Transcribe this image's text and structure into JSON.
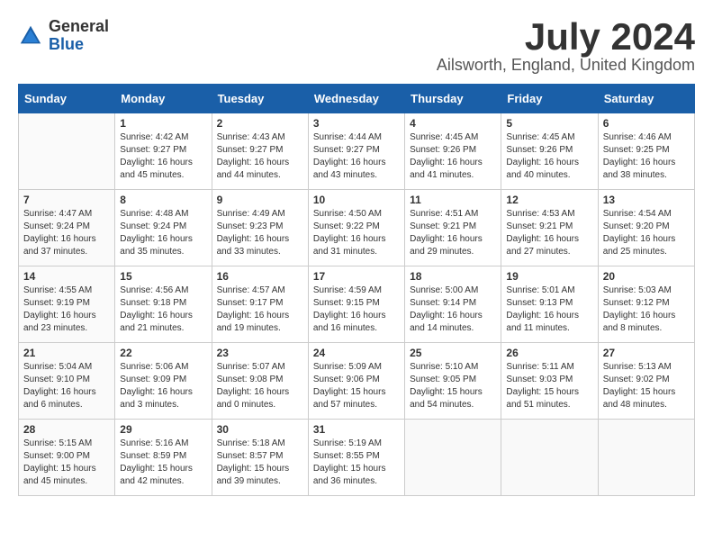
{
  "logo": {
    "general": "General",
    "blue": "Blue"
  },
  "title": {
    "month_year": "July 2024",
    "location": "Ailsworth, England, United Kingdom"
  },
  "days_of_week": [
    "Sunday",
    "Monday",
    "Tuesday",
    "Wednesday",
    "Thursday",
    "Friday",
    "Saturday"
  ],
  "weeks": [
    [
      {
        "day": "",
        "info": ""
      },
      {
        "day": "1",
        "info": "Sunrise: 4:42 AM\nSunset: 9:27 PM\nDaylight: 16 hours and 45 minutes."
      },
      {
        "day": "2",
        "info": "Sunrise: 4:43 AM\nSunset: 9:27 PM\nDaylight: 16 hours and 44 minutes."
      },
      {
        "day": "3",
        "info": "Sunrise: 4:44 AM\nSunset: 9:27 PM\nDaylight: 16 hours and 43 minutes."
      },
      {
        "day": "4",
        "info": "Sunrise: 4:45 AM\nSunset: 9:26 PM\nDaylight: 16 hours and 41 minutes."
      },
      {
        "day": "5",
        "info": "Sunrise: 4:45 AM\nSunset: 9:26 PM\nDaylight: 16 hours and 40 minutes."
      },
      {
        "day": "6",
        "info": "Sunrise: 4:46 AM\nSunset: 9:25 PM\nDaylight: 16 hours and 38 minutes."
      }
    ],
    [
      {
        "day": "7",
        "info": "Sunrise: 4:47 AM\nSunset: 9:24 PM\nDaylight: 16 hours and 37 minutes."
      },
      {
        "day": "8",
        "info": "Sunrise: 4:48 AM\nSunset: 9:24 PM\nDaylight: 16 hours and 35 minutes."
      },
      {
        "day": "9",
        "info": "Sunrise: 4:49 AM\nSunset: 9:23 PM\nDaylight: 16 hours and 33 minutes."
      },
      {
        "day": "10",
        "info": "Sunrise: 4:50 AM\nSunset: 9:22 PM\nDaylight: 16 hours and 31 minutes."
      },
      {
        "day": "11",
        "info": "Sunrise: 4:51 AM\nSunset: 9:21 PM\nDaylight: 16 hours and 29 minutes."
      },
      {
        "day": "12",
        "info": "Sunrise: 4:53 AM\nSunset: 9:21 PM\nDaylight: 16 hours and 27 minutes."
      },
      {
        "day": "13",
        "info": "Sunrise: 4:54 AM\nSunset: 9:20 PM\nDaylight: 16 hours and 25 minutes."
      }
    ],
    [
      {
        "day": "14",
        "info": "Sunrise: 4:55 AM\nSunset: 9:19 PM\nDaylight: 16 hours and 23 minutes."
      },
      {
        "day": "15",
        "info": "Sunrise: 4:56 AM\nSunset: 9:18 PM\nDaylight: 16 hours and 21 minutes."
      },
      {
        "day": "16",
        "info": "Sunrise: 4:57 AM\nSunset: 9:17 PM\nDaylight: 16 hours and 19 minutes."
      },
      {
        "day": "17",
        "info": "Sunrise: 4:59 AM\nSunset: 9:15 PM\nDaylight: 16 hours and 16 minutes."
      },
      {
        "day": "18",
        "info": "Sunrise: 5:00 AM\nSunset: 9:14 PM\nDaylight: 16 hours and 14 minutes."
      },
      {
        "day": "19",
        "info": "Sunrise: 5:01 AM\nSunset: 9:13 PM\nDaylight: 16 hours and 11 minutes."
      },
      {
        "day": "20",
        "info": "Sunrise: 5:03 AM\nSunset: 9:12 PM\nDaylight: 16 hours and 8 minutes."
      }
    ],
    [
      {
        "day": "21",
        "info": "Sunrise: 5:04 AM\nSunset: 9:10 PM\nDaylight: 16 hours and 6 minutes."
      },
      {
        "day": "22",
        "info": "Sunrise: 5:06 AM\nSunset: 9:09 PM\nDaylight: 16 hours and 3 minutes."
      },
      {
        "day": "23",
        "info": "Sunrise: 5:07 AM\nSunset: 9:08 PM\nDaylight: 16 hours and 0 minutes."
      },
      {
        "day": "24",
        "info": "Sunrise: 5:09 AM\nSunset: 9:06 PM\nDaylight: 15 hours and 57 minutes."
      },
      {
        "day": "25",
        "info": "Sunrise: 5:10 AM\nSunset: 9:05 PM\nDaylight: 15 hours and 54 minutes."
      },
      {
        "day": "26",
        "info": "Sunrise: 5:11 AM\nSunset: 9:03 PM\nDaylight: 15 hours and 51 minutes."
      },
      {
        "day": "27",
        "info": "Sunrise: 5:13 AM\nSunset: 9:02 PM\nDaylight: 15 hours and 48 minutes."
      }
    ],
    [
      {
        "day": "28",
        "info": "Sunrise: 5:15 AM\nSunset: 9:00 PM\nDaylight: 15 hours and 45 minutes."
      },
      {
        "day": "29",
        "info": "Sunrise: 5:16 AM\nSunset: 8:59 PM\nDaylight: 15 hours and 42 minutes."
      },
      {
        "day": "30",
        "info": "Sunrise: 5:18 AM\nSunset: 8:57 PM\nDaylight: 15 hours and 39 minutes."
      },
      {
        "day": "31",
        "info": "Sunrise: 5:19 AM\nSunset: 8:55 PM\nDaylight: 15 hours and 36 minutes."
      },
      {
        "day": "",
        "info": ""
      },
      {
        "day": "",
        "info": ""
      },
      {
        "day": "",
        "info": ""
      }
    ]
  ]
}
